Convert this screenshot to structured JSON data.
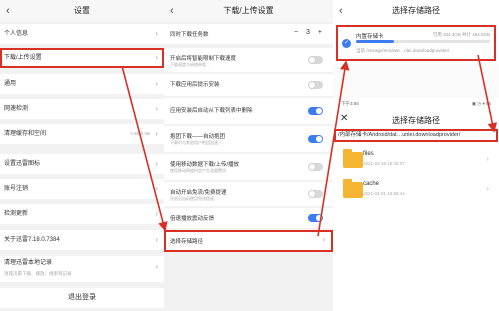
{
  "settings": {
    "title": "设置",
    "items": [
      {
        "label": "个人信息"
      },
      {
        "label": "下载/上传设置"
      },
      {
        "label": "通用"
      },
      {
        "label": "网速检测"
      },
      {
        "label": "清理缓存和空间",
        "extra": "3.9B/0.0B"
      },
      {
        "label": "设置迅雷图标"
      },
      {
        "label": "账号注销"
      },
      {
        "label": "检测更新"
      },
      {
        "label": "关于迅雷7.18.0.7384"
      },
      {
        "label": "清理迅雷本地记录",
        "sub": "清理迅雷下载、播放、搜索等记录"
      }
    ],
    "logout": "退出登录"
  },
  "download_settings": {
    "title": "下载/上传设置",
    "concurrent": {
      "label": "同时下载任务数",
      "minus": "−",
      "value": "3",
      "plus": "+"
    },
    "items": [
      {
        "label": "开启后将智能限制下载速度",
        "sub": "下载速度与网络带宽…",
        "on": false
      },
      {
        "label": "下载应用后提示安装",
        "on": false
      },
      {
        "label": "应用安装后自动从下载列表中删除",
        "on": true
      },
      {
        "label": "抱团下载——自动抱团",
        "sub": "下载时与其他用户抱团加速…",
        "on": true
      },
      {
        "label": "使用移动数据下载/上传/播放",
        "sub": "使用移动网络时会产生流量费用",
        "on": false
      },
      {
        "label": "自动开启免流/免费提速",
        "sub": "开启后自动使用免流提速…",
        "on": false
      },
      {
        "label": "倍速播放震动反馈",
        "on": true
      }
    ],
    "storage_path": "选择存储路径"
  },
  "storage_dialog": {
    "title": "选择存储路径",
    "card": {
      "name": "内置存储卡",
      "capacity": "可用 334.4GB 共计 464.5GB",
      "used_fraction": 0.28,
      "path": "当前 /storage/emulate…nlei.downloadprovider/"
    },
    "status_time": "下午3:56",
    "status_right": "▣ ◷ ▾ 56",
    "browser_title": "选择存储路径",
    "path": "/内部存储卡/Android/dat…unlei.downloadprovider/",
    "folders": [
      {
        "name": "files",
        "date": "2021-03-18 16:35:37"
      },
      {
        "name": "cache",
        "date": "2021-04-01 15:55:44"
      }
    ]
  },
  "icons": {
    "back": "back-arrow-icon",
    "close": "close-icon",
    "chevron": "chevron-right-icon",
    "folder": "folder-icon"
  },
  "colors": {
    "highlight": "#d93025",
    "accent": "#3d7cf0",
    "folder": "#f5b532"
  }
}
